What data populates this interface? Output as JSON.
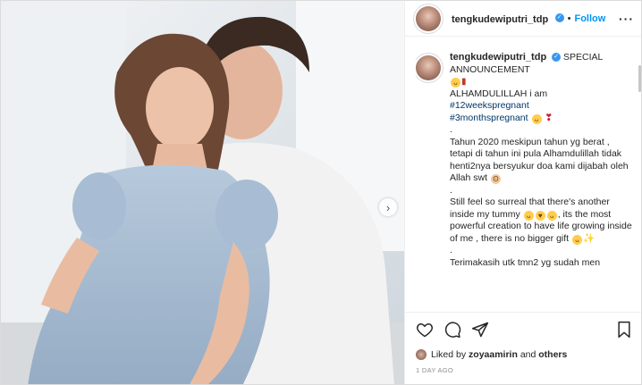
{
  "photo": {
    "alt_subject": "couple-photo",
    "next_icon": "chevron-right-icon"
  },
  "header": {
    "username": "tengkudewiputri_tdp",
    "verified_icon": "verified-badge-icon",
    "separator": "•",
    "follow_label": "Follow",
    "more_icon": "more-options-icon"
  },
  "caption": {
    "username": "tengkudewiputri_tdp",
    "announcement": "SPECIAL ANNOUNCEMENT",
    "line1": "ALHAMDULILLAH i am",
    "tag1": "#12weekspregnant",
    "tag2": "#3monthspregnant",
    "dot1": ".",
    "para1": "Tahun 2020 meskipun tahun yg berat , tetapi di tahun ini pula Alhamdulillah tidak henti2nya bersyukur doa kami dijabah oleh Allah swt",
    "dot2": ".",
    "para2a": "Still feel so surreal that there's another inside my tummy",
    "para2b": ", its the most powerful creation to have life growing inside of me , there is no bigger gift",
    "dot3": ".",
    "para3": "Terimakasih utk tmn2 yg sudah men"
  },
  "actions": {
    "like_icon": "heart-icon",
    "comment_icon": "comment-icon",
    "share_icon": "share-icon",
    "save_icon": "bookmark-icon",
    "liked_prefix": "Liked by",
    "liked_user": "zoyaamirin",
    "liked_suffix": "and",
    "liked_others": "others",
    "time_ago": "1 DAY AGO"
  },
  "colors": {
    "link": "#00376b",
    "follow": "#0095f6",
    "verified": "#3897f0",
    "muted": "#8e8e8e"
  }
}
